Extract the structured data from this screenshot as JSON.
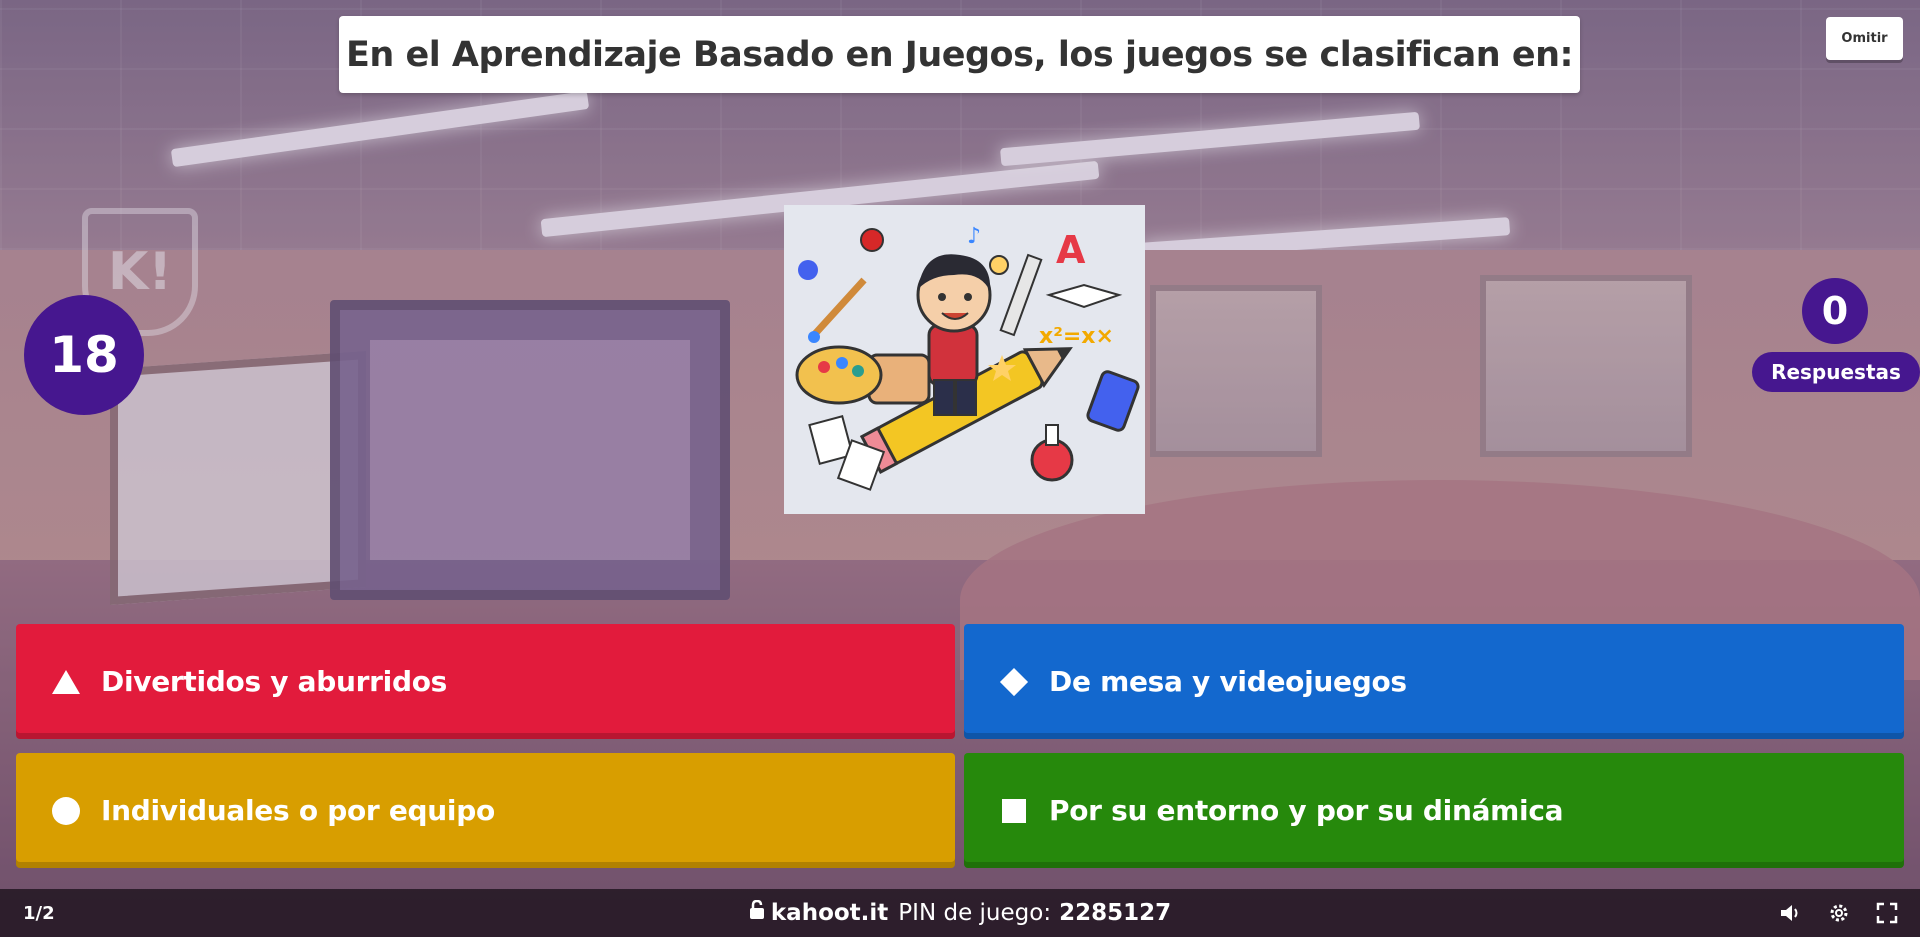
{
  "question": {
    "text": "En el Aprendizaje Basado en Juegos, los juegos se clasifican en:"
  },
  "skip_button": {
    "label": "Omitir"
  },
  "timer": {
    "value": "18"
  },
  "answers_count": {
    "value": "0",
    "label": "Respuestas"
  },
  "answers": [
    {
      "shape": "triangle-icon",
      "label": "Divertidos y aburridos",
      "color": "#e21b3c"
    },
    {
      "shape": "diamond-icon",
      "label": "De mesa y videojuegos",
      "color": "#1368ce"
    },
    {
      "shape": "circle-icon",
      "label": "Individuales o por equipo",
      "color": "#d89e00"
    },
    {
      "shape": "square-icon",
      "label": "Por su entorno y por su dinámica",
      "color": "#26890c"
    }
  ],
  "footer": {
    "question_counter": "1/2",
    "domain": "kahoot.it",
    "pin_label": "PIN de juego:",
    "pin": "2285127",
    "icons": [
      "lock-icon",
      "volume-icon",
      "settings-icon",
      "fullscreen-icon"
    ]
  },
  "colors": {
    "brand_purple": "#46178f"
  }
}
